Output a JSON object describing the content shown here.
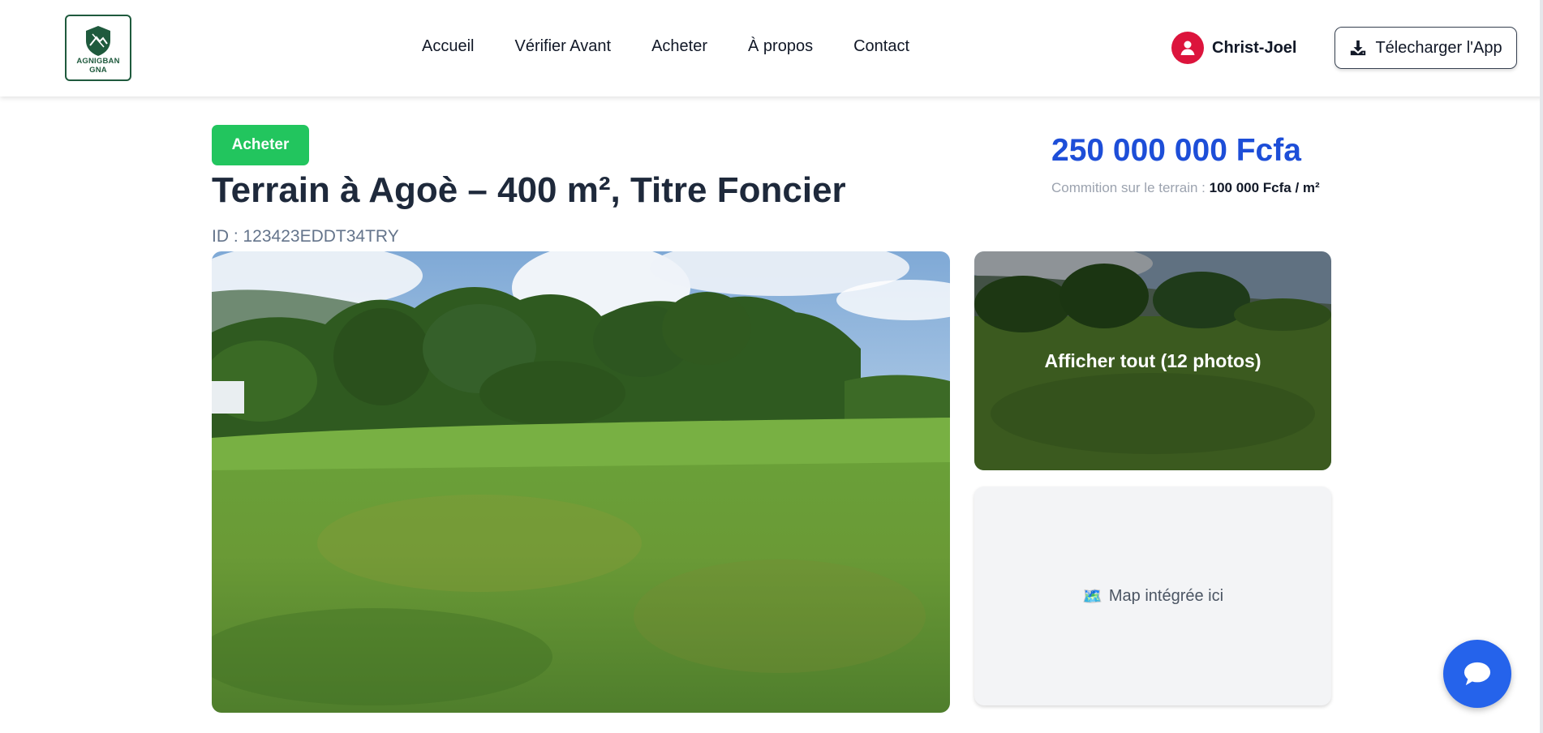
{
  "header": {
    "logo": {
      "line1": "AGNIGBAN",
      "line2": "GNA",
      "icon": "shield-mountain-logo"
    },
    "nav": [
      {
        "label": "Accueil"
      },
      {
        "label": "Vérifier Avant"
      },
      {
        "label": "Acheter"
      },
      {
        "label": "À propos"
      },
      {
        "label": "Contact"
      }
    ],
    "user": {
      "name": "Christ-Joel",
      "icon": "user-avatar-icon"
    },
    "download_label": "Télecharger l'App"
  },
  "listing": {
    "badge": "Acheter",
    "title": "Terrain à Agoè – 400 m², Titre Foncier",
    "id_text": "ID : 123423EDDT34TRY",
    "price": "250 000 000 Fcfa",
    "commission_label": "Commition sur le terrain :",
    "commission_value": "100 000 Fcfa / m²"
  },
  "gallery": {
    "show_all_label": "Afficher tout (12 photos)",
    "map_placeholder": "Map intégrée ici",
    "map_icon": "🗺️"
  },
  "colors": {
    "accent_blue": "#1d4ed8",
    "badge_green": "#22c55e",
    "avatar_red": "#dc143c",
    "chat_blue": "#2563eb",
    "logo_green": "#1f5a3d"
  }
}
